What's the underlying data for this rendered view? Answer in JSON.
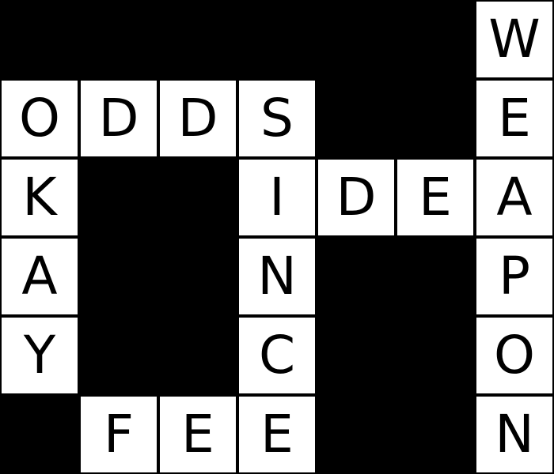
{
  "puzzle": {
    "colors": {
      "filled_square": "#ffffff",
      "blocked_square": "#000000",
      "letter": "#000000"
    },
    "rows": [
      [
        null,
        null,
        null,
        null,
        null,
        null,
        "W"
      ],
      [
        "O",
        "D",
        "D",
        "S",
        null,
        null,
        "E"
      ],
      [
        "K",
        null,
        null,
        "I",
        "D",
        "E",
        "A"
      ],
      [
        "A",
        null,
        null,
        "N",
        null,
        null,
        "P"
      ],
      [
        "Y",
        null,
        null,
        "C",
        null,
        null,
        "O"
      ],
      [
        null,
        "F",
        "E",
        "E",
        null,
        null,
        "N"
      ]
    ]
  }
}
